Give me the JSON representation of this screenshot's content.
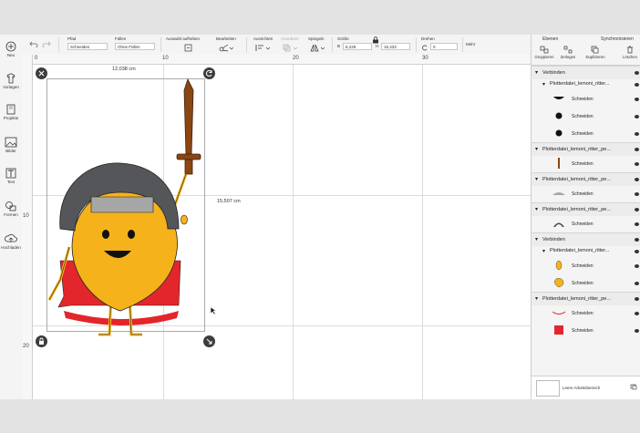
{
  "left_toolbar": {
    "items": [
      {
        "label": "Neu",
        "icon": "plus-icon"
      },
      {
        "label": "Vorlagen",
        "icon": "shirt-icon"
      },
      {
        "label": "Projekte",
        "icon": "book-icon"
      },
      {
        "label": "Bilder",
        "icon": "image-icon"
      },
      {
        "label": "Text",
        "icon": "text-icon"
      },
      {
        "label": "Formen",
        "icon": "shapes-icon"
      },
      {
        "label": "Hochladen",
        "icon": "upload-icon"
      }
    ]
  },
  "top_toolbar": {
    "pfad_label": "Pfad",
    "pfad_value": "Schneiden",
    "fuellen_label": "Füllen",
    "fuellen_value": "Ohne Füllen",
    "auswahl_label": "Auswahl aufheben",
    "bearbeiten_label": "Bearbeiten",
    "ausrichten_label": "Ausrichten",
    "anordnen_label": "Anordnen",
    "spiegeln_label": "Spiegeln",
    "groesse_label": "Größe",
    "b_label": "B",
    "b_value": "8,228",
    "h_label": "H",
    "h_value": "15,333",
    "drehen_label": "Drehen",
    "drehen_value": "0",
    "mehr_label": "Mehr"
  },
  "ruler": {
    "top_ticks": [
      "0",
      "10",
      "20",
      "30"
    ],
    "left_ticks": [
      "10",
      "20"
    ]
  },
  "canvas": {
    "width_label": "12,038 cm",
    "height_label": "15,507 cm"
  },
  "right_panel": {
    "tab_ebenen": "Ebenen",
    "tab_sync": "Synchronisieren",
    "actions": [
      {
        "label": "Gruppieren",
        "icon": "group-icon"
      },
      {
        "label": "Zerlegen",
        "icon": "ungroup-icon"
      },
      {
        "label": "Duplizieren",
        "icon": "duplicate-icon"
      },
      {
        "label": "Löschen",
        "icon": "delete-icon"
      }
    ],
    "layers": [
      {
        "kind": "group",
        "label": "Verbinden"
      },
      {
        "kind": "subgroup",
        "label": "Plotterdatei_lemoni_ritter..."
      },
      {
        "kind": "item",
        "label": "Schneiden",
        "thumb": "mouth",
        "color": "#111111"
      },
      {
        "kind": "item",
        "label": "Schneiden",
        "thumb": "dot",
        "color": "#111111"
      },
      {
        "kind": "item",
        "label": "Schneiden",
        "thumb": "dot",
        "color": "#111111"
      },
      {
        "kind": "group",
        "label": "Plotterdatei_lemoni_ritter_pe..."
      },
      {
        "kind": "item",
        "label": "Schneiden",
        "thumb": "sword",
        "color": "#8b4513"
      },
      {
        "kind": "group",
        "label": "Plotterdatei_lemoni_ritter_pe..."
      },
      {
        "kind": "item",
        "label": "Schneiden",
        "thumb": "helmet",
        "color": "#a6a6a6"
      },
      {
        "kind": "group",
        "label": "Plotterdatei_lemoni_ritter_pe..."
      },
      {
        "kind": "item",
        "label": "Schneiden",
        "thumb": "arc",
        "color": "#4a4a4a"
      },
      {
        "kind": "group",
        "label": "Verbinden"
      },
      {
        "kind": "subgroup",
        "label": "Plotterdatei_lemoni_ritter..."
      },
      {
        "kind": "item",
        "label": "Schneiden",
        "thumb": "drop",
        "color": "#f5b21b"
      },
      {
        "kind": "item",
        "label": "Schneiden",
        "thumb": "lemon",
        "color": "#f5b21b"
      },
      {
        "kind": "group",
        "label": "Plotterdatei_lemoni_ritter_pe..."
      },
      {
        "kind": "item",
        "label": "Schneiden",
        "thumb": "curve",
        "color": "#e3262b"
      },
      {
        "kind": "item",
        "label": "Schneiden",
        "thumb": "rect",
        "color": "#e3262b"
      }
    ],
    "footer_label": "Leere Arbeitsbereich"
  },
  "colors": {
    "lemon": "#f5b21b",
    "cape": "#e3262b",
    "helmet_dark": "#555659",
    "helmet_light": "#a6a6a6",
    "sword": "#8b4513"
  }
}
